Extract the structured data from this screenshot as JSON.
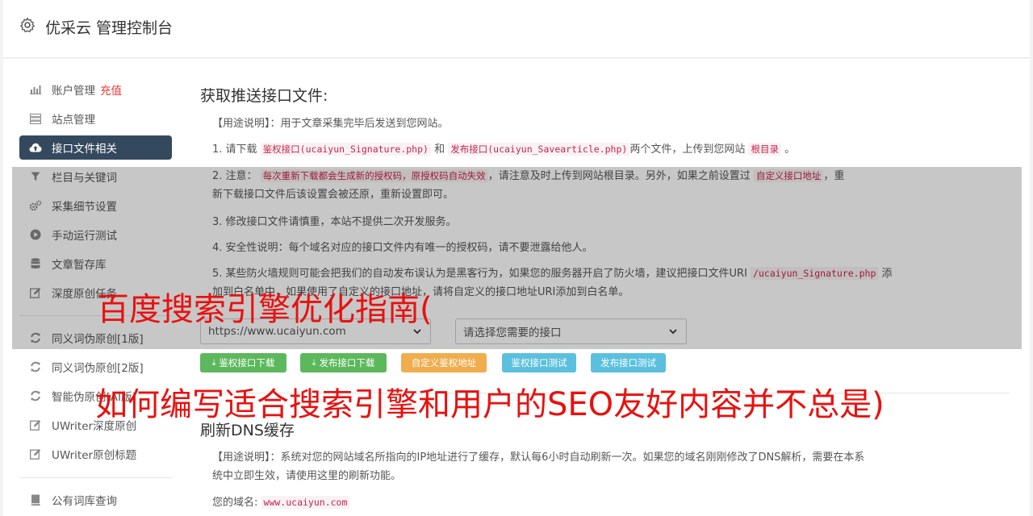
{
  "header": {
    "title": "优采云 管理控制台",
    "icon": "gear-icon"
  },
  "sidebar": {
    "items": [
      {
        "label": "账户管理",
        "extra": "充值",
        "icon": "bar-chart-icon"
      },
      {
        "label": "站点管理",
        "icon": "server-icon"
      },
      {
        "label": "接口文件相关",
        "icon": "cloud-upload-icon",
        "active": true
      },
      {
        "label": "栏目与关键词",
        "icon": "filter-icon"
      },
      {
        "label": "采集细节设置",
        "icon": "cogs-icon"
      },
      {
        "label": "手动运行测试",
        "icon": "play-circle-icon"
      },
      {
        "label": "文章暂存库",
        "icon": "database-icon"
      },
      {
        "label": "深度原创任务",
        "icon": "edit-icon"
      },
      {
        "label": "同义词伪原创[1版]",
        "icon": "refresh-icon"
      },
      {
        "label": "同义词伪原创[2版]",
        "icon": "refresh-icon"
      },
      {
        "label": "智能伪原创[AI版]",
        "icon": "refresh-icon"
      },
      {
        "label": "UWriter深度原创",
        "icon": "edit-icon"
      },
      {
        "label": "UWriter原创标题",
        "icon": "edit-icon"
      },
      {
        "label": "公有词库查询",
        "icon": "book-icon"
      }
    ]
  },
  "main": {
    "section1": {
      "title": "获取推送接口文件:",
      "usage": "【用途说明】：用于文章采集完毕后发送到您网站。",
      "item1": {
        "a": "1. 请下载",
        "code1": "鉴权接口(ucaiyun_Signature.php)",
        "b": "和",
        "code2": "发布接口(ucaiyun_Savearticle.php)",
        "c": "两个文件，上传到您网站",
        "code3": "根目录",
        "d": "。"
      },
      "item2": {
        "a": "2. 注意：",
        "code1": "每次重新下载都会生成新的授权码，原授权码自动失效",
        "b": "，请注意及时上传到网站根目录。另外，如果之前设置过",
        "code2": "自定义接口地址",
        "c": "，重",
        "d": "新下载接口文件后该设置会被还原，重新设置即可。"
      },
      "item3": "3. 修改接口文件请慎重，本站不提供二次开发服务。",
      "item4": "4. 安全性说明：每个域名对应的接口文件内有唯一的授权码，请不要泄露给他人。",
      "item5": {
        "a": "5. 某些防火墙规则可能会把我们的自动发布误认为是黑客行为，如果您的服务器开启了防火墙，建议把接口文件URI",
        "code1": "/ucaiyun_Signature.php",
        "b": "添",
        "c": "加到白名单中，如果使用了自定义的接口地址，请将自定义的接口地址URI添加到白名单。"
      },
      "site_select": "https://www.ucaiyun.com",
      "api_select": "请选择您需要的接口",
      "buttons": {
        "sig_download": "鉴权接口下载",
        "pub_download": "发布接口下载",
        "custom_sig": "自定义鉴权地址",
        "sig_test": "鉴权接口测试",
        "pub_test": "发布接口测试"
      }
    },
    "section2": {
      "title": "刷新DNS缓存",
      "usage_line1": "【用途说明】：系统对您的网站域名所指向的IP地址进行了缓存，默认每6小时自动刷新一次。如果您的域名刚刚修改了DNS解析，需要在本系",
      "usage_line2": "统中立即生效，请使用这里的刷新功能。",
      "domain_label": "您的域名:",
      "domain_value": "www.ucaiyun.com"
    }
  },
  "overlay_text": {
    "line1": "百度搜索引擎优化指南(",
    "line2": "如何编写适合搜索引擎和用户的SEO友好内容并不总是)"
  },
  "colors": {
    "active_nav": "#34495e",
    "green_btn": "#5cb85c",
    "orange_btn": "#f0ad4e",
    "blue_btn": "#5bc0de",
    "overlay_text": "#e8110f",
    "code_text": "#c7254e"
  }
}
